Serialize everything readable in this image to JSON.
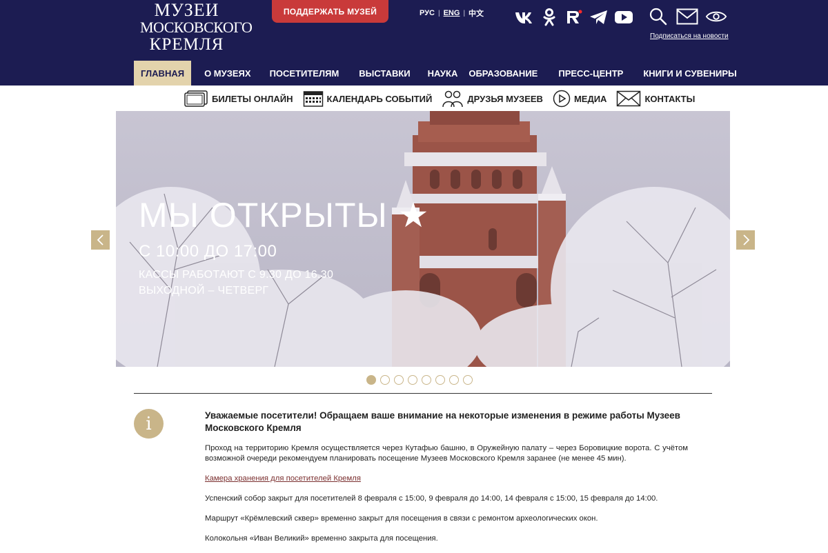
{
  "header": {
    "logo": {
      "line1": "МУЗЕИ",
      "line2": "МОСКОВСКОГО",
      "line3": "КРЕМЛЯ"
    },
    "support_label": "ПОДДЕРЖАТЬ МУЗЕЙ",
    "languages": [
      {
        "label": "РУС",
        "active": false
      },
      {
        "label": "ENG",
        "active": true
      },
      {
        "label": "中文",
        "active": false
      }
    ],
    "socials": [
      "vk-icon",
      "odnoklassniki-icon",
      "rutube-icon",
      "telegram-icon",
      "youtube-icon"
    ],
    "tools": [
      "search-icon",
      "mail-icon",
      "eye-icon"
    ],
    "subscribe_label": "Подписаться на новости"
  },
  "main_nav": [
    {
      "label": "ГЛАВНАЯ",
      "active": true
    },
    {
      "label": "О МУЗЕЯХ",
      "active": false
    },
    {
      "label": "ПОСЕТИТЕЛЯМ",
      "active": false
    },
    {
      "label": "ВЫСТАВКИ",
      "active": false
    },
    {
      "label": "НАУКА",
      "active": false
    },
    {
      "label": "ОБРАЗОВАНИЕ",
      "active": false
    },
    {
      "label": "ПРЕСС-ЦЕНТР",
      "active": false
    },
    {
      "label": "КНИГИ И СУВЕНИРЫ",
      "active": false
    }
  ],
  "sub_nav": [
    {
      "label": "БИЛЕТЫ ОНЛАЙН",
      "icon": "tickets-icon"
    },
    {
      "label": "КАЛЕНДАРЬ СОБЫТИЙ",
      "icon": "calendar-icon"
    },
    {
      "label": "ДРУЗЬЯ МУЗЕЕВ",
      "icon": "friends-icon"
    },
    {
      "label": "МЕДИА",
      "icon": "play-icon"
    },
    {
      "label": "КОНТАКТЫ",
      "icon": "envelope-icon"
    }
  ],
  "hero": {
    "headline": "МЫ ОТКРЫТЫ ★",
    "hours": "С 10:00 ДО 17:00",
    "cash": "КАССЫ РАБОТАЮТ С 9.30 ДО 16.30",
    "dayoff": "ВЫХОДНОЙ – ЧЕТВЕРГ",
    "slide_count": 8,
    "active_slide": 1
  },
  "notice": {
    "title": "Уважаемые посетители! Обращаем ваше внимание на некоторые изменения в режиме работы Музеев Московского Кремля",
    "p1": "Проход на территорию Кремля осуществляется через Кутафью башню, в Оружейную палату – через Боровицкие ворота. С учётом возможной очереди рекомендуем планировать посещение Музеев Московского Кремля заранее (не менее 45 мин).",
    "link": "Камера хранения для посетителей Кремля",
    "p2": "Успенский собор закрыт для посетителей 8 февраля с 15:00, 9 февраля до 14:00, 14 февраля с 15:00, 15 февраля до 14:00.",
    "p3": "Маршрут «Крёмлевский сквер» временно закрыт для посещения в связи с ремонтом археологических окон.",
    "p4": "Колокольня «Иван Великий» временно закрыта для посещения."
  },
  "colors": {
    "header_bg": "#1c1c52",
    "accent_gold": "#c9b589",
    "active_nav_bg": "#e3d3ac",
    "support_red": "#c93a3a",
    "link": "#7a2e2e"
  }
}
